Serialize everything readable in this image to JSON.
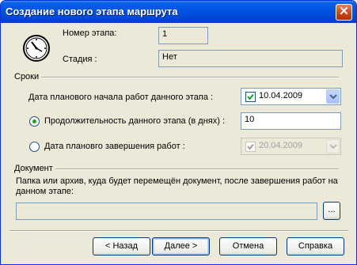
{
  "window": {
    "title": "Создание нового этапа маршрута",
    "close_glyph": "✕"
  },
  "header": {
    "stage_number_label": "Номер этапа:",
    "stage_number_value": "1",
    "stage_label": "Стадия :",
    "stage_value": "Нет",
    "icon": "clock-icon"
  },
  "terms": {
    "section_title": "Сроки",
    "planned_start_label": "Дата планового начала работ данного этапа :",
    "planned_start_value": "10.04.2009",
    "planned_start_checked": true,
    "duration_label": "Продолжительность данного этапа (в днях) :",
    "duration_value": "10",
    "duration_selected": true,
    "planned_end_label": "Дата плановго завершения работ :",
    "planned_end_value": "20.04.2009",
    "planned_end_selected": false
  },
  "document": {
    "section_title": "Документ",
    "description": "Папка или архив, куда будет перемещён документ, после завершения работ на данном этапе:",
    "path_value": "",
    "browse_label": "..."
  },
  "buttons": {
    "back": "< Назад",
    "next": "Далее >",
    "cancel": "Отмена",
    "help": "Справка"
  },
  "colors": {
    "title_bar": "#0054e3",
    "dialog_bg": "#ece9d8",
    "radio_dot": "#21a121",
    "field_border": "#7f9db9"
  }
}
